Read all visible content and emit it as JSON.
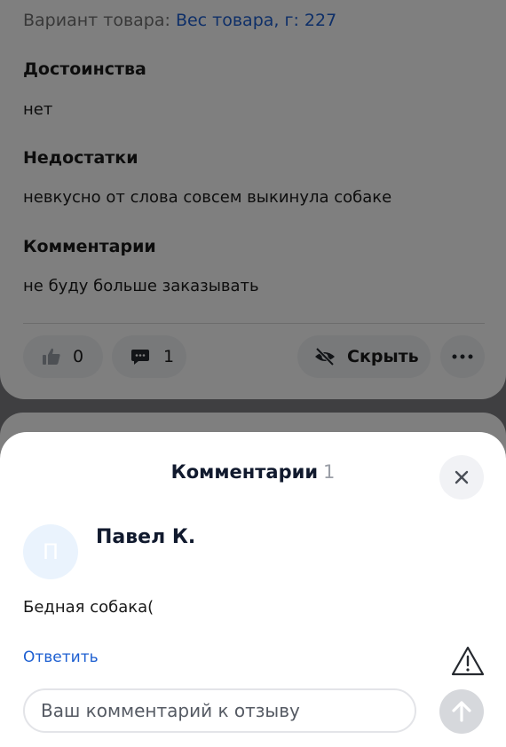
{
  "review": {
    "variant_label": "Вариант товара:",
    "variant_value": "Вес товара, г: 227",
    "pros_title": "Достоинства",
    "pros_text": "нет",
    "cons_title": "Недостатки",
    "cons_text": "невкусно от слова совсем выкинула собаке",
    "comments_title": "Комментарии",
    "comments_text": "не буду больше заказывать",
    "likes_count": "0",
    "comments_count": "1",
    "hide_label": "Скрыть"
  },
  "sheet": {
    "title": "Комментарии",
    "count": "1",
    "comment": {
      "avatar_letter": "П",
      "author": "Павел К.",
      "text": "Бедная собака(",
      "reply_label": "Ответить"
    },
    "input": {
      "placeholder": "Ваш комментарий к отзыву",
      "value": ""
    }
  },
  "colors": {
    "accent_link": "#1d5fd1",
    "title_dark": "#111a2e",
    "avatar_bg": "#eaf3fd",
    "button_bg": "#f1f2f5",
    "send_disabled": "#d6d8dc"
  },
  "icons": {
    "like": "thumbs-up-icon",
    "comment": "speech-bubble-icon",
    "hide": "eye-off-icon",
    "more": "ellipsis-icon",
    "close": "close-icon",
    "report": "warning-triangle-icon",
    "send": "arrow-up-icon"
  }
}
